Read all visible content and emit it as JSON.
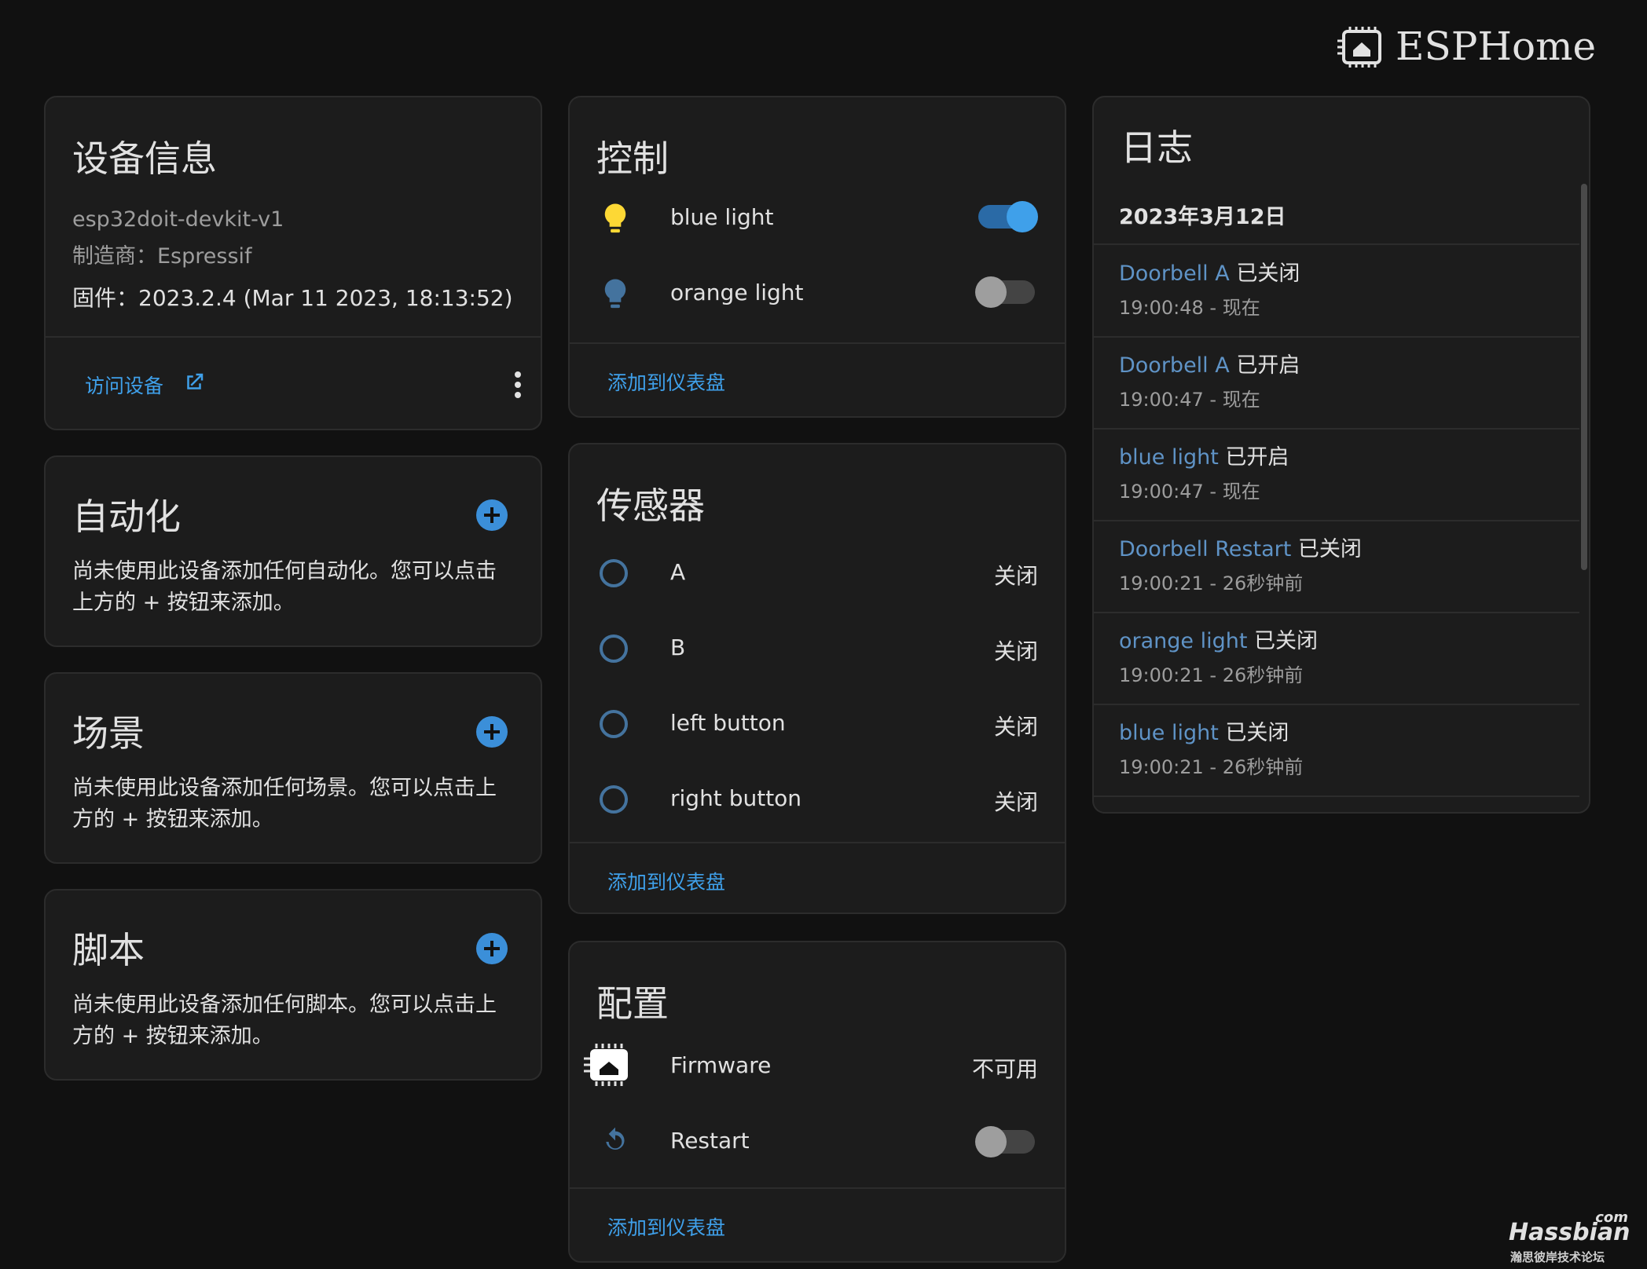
{
  "brand": {
    "title": "ESPHome"
  },
  "device_info": {
    "title": "设备信息",
    "model": "esp32doit-devkit-v1",
    "manufacturer": "制造商：Espressif",
    "firmware": "固件：2023.2.4 (Mar 11 2023, 18:13:52)",
    "visit_label": "访问设备"
  },
  "automation": {
    "title": "自动化",
    "desc_line1": "尚未使用此设备添加任何自动化。您可以点击",
    "desc_line2": "上方的 + 按钮来添加。"
  },
  "scenes": {
    "title": "场景",
    "desc_line1": "尚未使用此设备添加任何场景。您可以点击上",
    "desc_line2": "方的 + 按钮来添加。"
  },
  "scripts": {
    "title": "脚本",
    "desc_line1": "尚未使用此设备添加任何脚本。您可以点击上",
    "desc_line2": "方的 + 按钮来添加。"
  },
  "controls": {
    "title": "控制",
    "items": [
      {
        "label": "blue light",
        "state": "on",
        "icon": "lightbulb-icon",
        "icon_color": "#fdd835"
      },
      {
        "label": "orange light",
        "state": "off",
        "icon": "lightbulb-icon",
        "icon_color": "#44739e"
      }
    ],
    "add_label": "添加到仪表盘"
  },
  "sensors": {
    "title": "传感器",
    "items": [
      {
        "label": "A",
        "value": "关闭"
      },
      {
        "label": "B",
        "value": "关闭"
      },
      {
        "label": "left button",
        "value": "关闭"
      },
      {
        "label": "right button",
        "value": "关闭"
      }
    ],
    "add_label": "添加到仪表盘"
  },
  "config": {
    "title": "配置",
    "items": [
      {
        "label": "Firmware",
        "value": "不可用",
        "icon": "esphome-chip-icon"
      },
      {
        "label": "Restart",
        "state": "off",
        "icon": "restart-icon"
      }
    ],
    "add_label": "添加到仪表盘"
  },
  "logbook": {
    "title": "日志",
    "date": "2023年3月12日",
    "entries": [
      {
        "name": "Doorbell A",
        "action": "已关闭",
        "time": "19:00:48 - 现在"
      },
      {
        "name": "Doorbell A",
        "action": "已开启",
        "time": "19:00:47 - 现在"
      },
      {
        "name": "blue light",
        "action": "已开启",
        "time": "19:00:47 - 现在"
      },
      {
        "name": "Doorbell Restart",
        "action": "已关闭",
        "time": "19:00:21 - 26秒钟前"
      },
      {
        "name": "orange light",
        "action": "已关闭",
        "time": "19:00:21 - 26秒钟前"
      },
      {
        "name": "blue light",
        "action": "已关闭",
        "time": "19:00:21 - 26秒钟前"
      }
    ]
  },
  "watermark": {
    "brand": "Hassbian",
    "suffix": "com",
    "tagline": "瀚思彼岸技术论坛"
  },
  "colors": {
    "accent": "#3fa0ea",
    "toggle_on": "#3fa0ea",
    "icon_inactive": "#44739e",
    "background": "#111111",
    "card": "#1c1c1c"
  }
}
